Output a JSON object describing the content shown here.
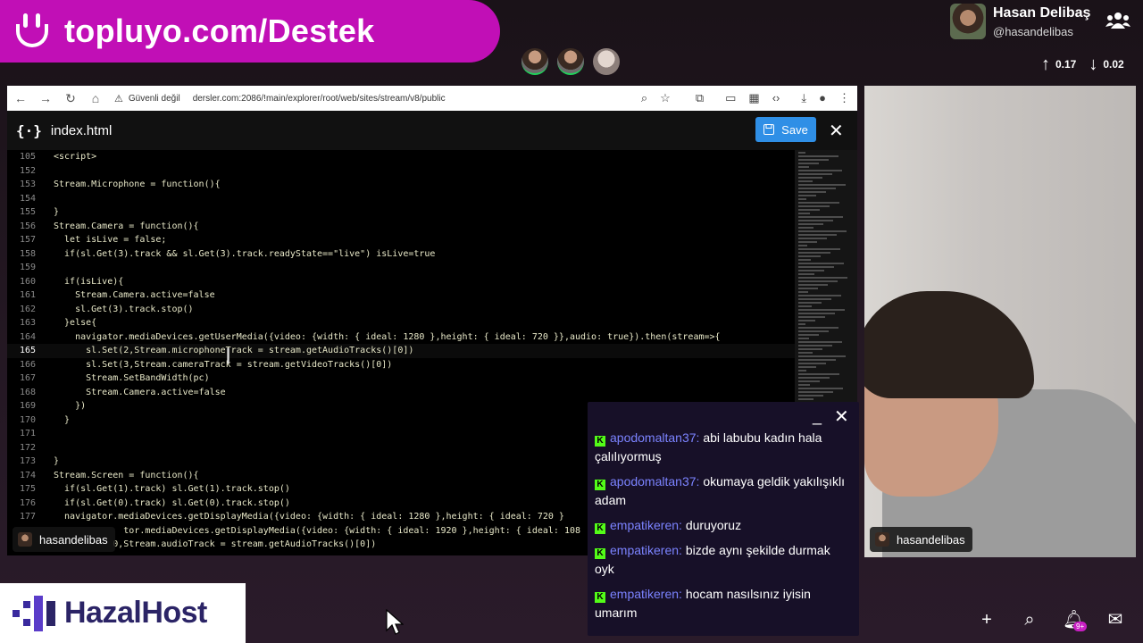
{
  "banner": {
    "text": "topluyo.com/Destek"
  },
  "profile": {
    "name": "Hasan Delibaş",
    "handle": "@hasandelibas"
  },
  "network": {
    "up": "0.17",
    "down": "0.02"
  },
  "browser": {
    "security_label": "Güvenli değil",
    "url": "dersler.com:2086/!main/explorer/root/web/sites/stream/v8/public"
  },
  "editor": {
    "file_name": "index.html",
    "save_label": "Save",
    "lines": [
      {
        "n": "105",
        "t": "<script>"
      },
      {
        "n": "152",
        "t": ""
      },
      {
        "n": "153",
        "t": "Stream.Microphone = function(){"
      },
      {
        "n": "154",
        "t": ""
      },
      {
        "n": "155",
        "t": "}"
      },
      {
        "n": "156",
        "t": "Stream.Camera = function(){"
      },
      {
        "n": "157",
        "t": "  let isLive = false;"
      },
      {
        "n": "158",
        "t": "  if(sl.Get(3).track && sl.Get(3).track.readyState==\"live\") isLive=true"
      },
      {
        "n": "159",
        "t": ""
      },
      {
        "n": "160",
        "t": "  if(isLive){"
      },
      {
        "n": "161",
        "t": "    Stream.Camera.active=false"
      },
      {
        "n": "162",
        "t": "    sl.Get(3).track.stop()"
      },
      {
        "n": "163",
        "t": "  }else{"
      },
      {
        "n": "164",
        "t": "    navigator.mediaDevices.getUserMedia({video: {width: { ideal: 1280 },height: { ideal: 720 }},audio: true}).then(stream=>{"
      },
      {
        "n": "165",
        "t": "      sl.Set(2,Stream.microphoneTrack = stream.getAudioTracks()[0])"
      },
      {
        "n": "166",
        "t": "      sl.Set(3,Stream.cameraTrack = stream.getVideoTracks()[0])"
      },
      {
        "n": "167",
        "t": "      Stream.SetBandWidth(pc)"
      },
      {
        "n": "168",
        "t": "      Stream.Camera.active=false"
      },
      {
        "n": "169",
        "t": "    })"
      },
      {
        "n": "170",
        "t": "  }"
      },
      {
        "n": "171",
        "t": ""
      },
      {
        "n": "172",
        "t": ""
      },
      {
        "n": "173",
        "t": "}"
      },
      {
        "n": "174",
        "t": "Stream.Screen = function(){"
      },
      {
        "n": "175",
        "t": "  if(sl.Get(1).track) sl.Get(1).track.stop()"
      },
      {
        "n": "176",
        "t": "  if(sl.Get(0).track) sl.Get(0).track.stop()"
      },
      {
        "n": "177",
        "t": "  navigator.mediaDevices.getDisplayMedia({video: {width: { ideal: 1280 },height: { ideal: 720 }"
      },
      {
        "n": "",
        "t": "             tor.mediaDevices.getDisplayMedia({video: {width: { ideal: 1920 },height: { ideal: 108"
      },
      {
        "n": "",
        "t": "           0,Stream.audioTrack = stream.getAudioTracks()[0])"
      }
    ],
    "active_line": "165"
  },
  "name_tags": {
    "screen": "hasandelibas",
    "camera": "hasandelibas"
  },
  "chat": {
    "messages": [
      {
        "user": "apodomaltan37:",
        "text": "abi labubu kadın hala çalılıyormuş"
      },
      {
        "user": "apodomaltan37:",
        "text": "okumaya geldik yakılışıklı adam"
      },
      {
        "user": "empatikeren:",
        "text": "duruyoruz"
      },
      {
        "user": "empatikeren:",
        "text": "bizde aynı şekilde durmak oyk"
      },
      {
        "user": "empatikeren:",
        "text": "hocam nasılsınız iyisin umarım"
      }
    ]
  },
  "sponsor": {
    "text": "HazalHost"
  },
  "bottom": {
    "badge": "9+"
  },
  "colors": {
    "banner": "#c10fb6",
    "chat_user": "#7b83ff",
    "save": "#2f8fe6",
    "kick": "#53fc18"
  }
}
